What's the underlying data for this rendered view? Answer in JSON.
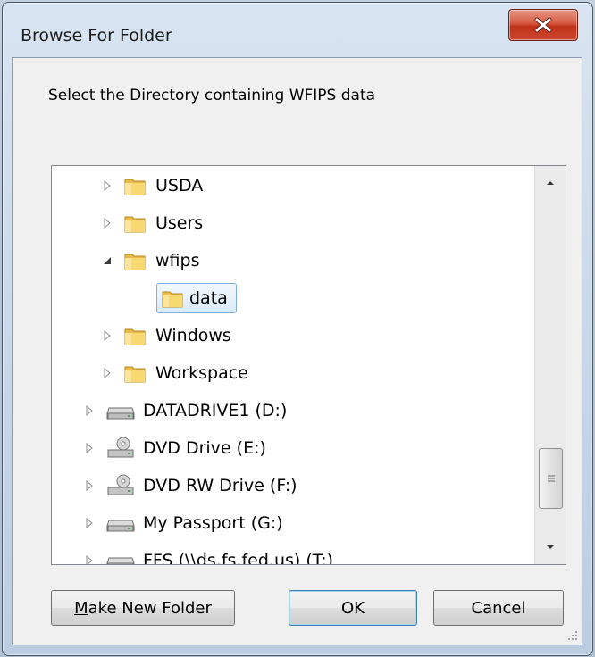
{
  "window": {
    "title": "Browse For Folder"
  },
  "dialog": {
    "instruction": "Select the Directory containing WFIPS data"
  },
  "tree": {
    "items": [
      {
        "label": "USDA",
        "icon": "folder-icon",
        "expander": "collapsed",
        "selected": false
      },
      {
        "label": "Users",
        "icon": "folder-icon",
        "expander": "collapsed",
        "selected": false
      },
      {
        "label": "wfips",
        "icon": "folder-icon",
        "expander": "expanded",
        "selected": false
      },
      {
        "label": "data",
        "icon": "folder-icon",
        "expander": "none",
        "selected": true
      },
      {
        "label": "Windows",
        "icon": "folder-icon",
        "expander": "collapsed",
        "selected": false
      },
      {
        "label": "Workspace",
        "icon": "folder-icon",
        "expander": "collapsed",
        "selected": false
      },
      {
        "label": "DATADRIVE1 (D:)",
        "icon": "hard-drive-icon",
        "expander": "collapsed",
        "selected": false
      },
      {
        "label": "DVD Drive (E:)",
        "icon": "dvd-drive-icon",
        "expander": "collapsed",
        "selected": false
      },
      {
        "label": "DVD RW Drive (F:)",
        "icon": "dvd-drive-icon",
        "expander": "collapsed",
        "selected": false
      },
      {
        "label": "My Passport (G:)",
        "icon": "hard-drive-icon",
        "expander": "collapsed",
        "selected": false
      },
      {
        "label": "FFS (\\\\ds.fs.fed.us) (T:)",
        "icon": "network-drive-icon",
        "expander": "collapsed",
        "selected": false
      }
    ]
  },
  "buttons": {
    "make_new_folder": "Make New Folder",
    "ok": "OK",
    "cancel": "Cancel"
  },
  "colors": {
    "selection_border": "#84acdd",
    "folder_yellow": "#f5cf56",
    "close_red": "#c0311a"
  }
}
